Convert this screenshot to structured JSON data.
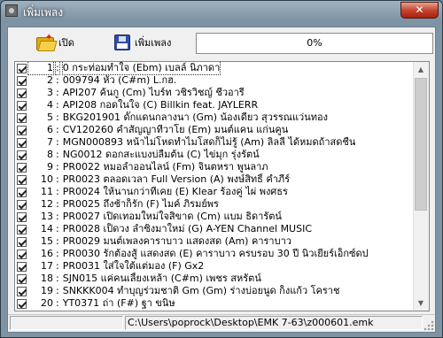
{
  "window": {
    "title": "เพิ่มเพลง",
    "close_label": "✕"
  },
  "toolbar": {
    "open_label": "เปิด",
    "open_icon": "open-folder-icon",
    "add_label": "เพิ่มเพลง",
    "add_icon": "floppy-disk-icon"
  },
  "progress": {
    "value": 0,
    "text": "0%",
    "fill_color": "#2aa34a"
  },
  "songs": [
    {
      "num": "1",
      "text": "0 กระท่อมทำใจ (Ebm) เบลล์ นิภาดา",
      "checked": true
    },
    {
      "num": "2",
      "text": "009794 หัว (C#m) L.กฮ.",
      "checked": true
    },
    {
      "num": "3",
      "text": "API207 ค้นกู (Cm) ไบร์ท วชิรวิชญ์   ชีวอารี",
      "checked": true
    },
    {
      "num": "4",
      "text": "API208 กอดในใจ (C) Billkin feat. JAYLERR",
      "checked": true
    },
    {
      "num": "5",
      "text": "BKG201901 ดั๊กแดนกลางนา (Gm) น้องเดียว สุวรรณแว่นทอง",
      "checked": true
    },
    {
      "num": "6",
      "text": "CV120260 คำสัญญาที่วาโย (Em) มนต์แคน แก่นคูน",
      "checked": true
    },
    {
      "num": "7",
      "text": "MGN000893 หน้าไม่โหดทำไมโสดก็ไม่รู้ (Am) ลิลลี่ ได้หมดถ้าสดชื่น",
      "checked": true
    },
    {
      "num": "8",
      "text": "NG0012 ดอกสะแบงบ่ลืมต้น (C) ไข่มุก รุ่งรัตน์",
      "checked": true
    },
    {
      "num": "9",
      "text": "PR0022 หมอลำออนไลน์ (Fm) จินตหรา พูนลาภ",
      "checked": true
    },
    {
      "num": "10",
      "text": "PR0023 ตลอดเวลา Full Version (A) พงษ์สิทธิ์ คำภีร์",
      "checked": true
    },
    {
      "num": "11",
      "text": "PR0024 ให้นานกว่าที่เคย (E) Klear ร้องคู่ ไผ่ พงศธร",
      "checked": true
    },
    {
      "num": "12",
      "text": "PR0025 ถึงช้าก็รัก  (F) ไมค์ ภิรมย์พร",
      "checked": true
    },
    {
      "num": "13",
      "text": "PR0027 เปิดเทอมใหม่ใจสิขาด (Cm) แบม ธิดารัตน์",
      "checked": true
    },
    {
      "num": "14",
      "text": "PR0028 เป็ดวง ลำซิ่งมาใหม่ (G) A-YEN Channel MUSIC",
      "checked": true
    },
    {
      "num": "15",
      "text": "PR0029 มนต์เพลงคาราบาว แสดงสด (Am) คาราบาว",
      "checked": true
    },
    {
      "num": "16",
      "text": "PR0030 รักต้องสู้ แสดงสด (E) คาราบาว ครบรอบ 30 ปี นิวเยียร์เอ็กซ์ดป",
      "checked": true
    },
    {
      "num": "17",
      "text": "PR0031 ใส่ใจใต้แต่มอง (F) Gx2",
      "checked": true
    },
    {
      "num": "18",
      "text": "SJN015 แค่คนเลี้ยงเหล้า (C#m) เพชร สหรัตน์",
      "checked": true
    },
    {
      "num": "19",
      "text": "SNKKK004 ทำบุญร่วมชาติ Gm (Gm) ร่างบ่อยนูด ก็งแก้ว โคราช",
      "checked": true
    },
    {
      "num": "20",
      "text": "YT0371 ถ่า (F#) ฐา ขนิษ",
      "checked": true
    }
  ],
  "status": {
    "path": "C:\\Users\\poprock\\Desktop\\EMK 7-63\\z000601.emk"
  }
}
